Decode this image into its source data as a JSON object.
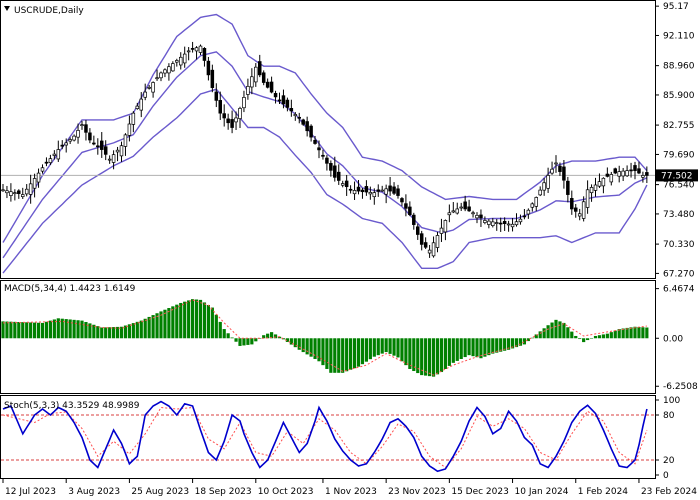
{
  "symbol_title": "USCRUDE,Daily",
  "colors": {
    "bollinger": "#6a5acd",
    "candle": "#000000",
    "macd_bar": "#008000",
    "macd_signal": "#ff4d4d",
    "stoch_main": "#0000cd",
    "stoch_signal": "#ff4d4d",
    "level_line": "#cc0000",
    "price_marker_bg": "#000000"
  },
  "chart_data": [
    {
      "type": "candlestick",
      "panel": "price",
      "title": "USCRUDE,Daily",
      "ylim": [
        67.0,
        95.5
      ],
      "y_ticks": [
        "95.17",
        "92.110",
        "88.960",
        "85.900",
        "82.755",
        "79.690",
        "76.540",
        "73.480",
        "70.330",
        "67.270"
      ],
      "current_price": "77.502",
      "x_ticks": [
        "12 Jul 2023",
        "3 Aug 2023",
        "25 Aug 2023",
        "18 Sep 2023",
        "10 Oct 2023",
        "1 Nov 2023",
        "23 Nov 2023",
        "15 Dec 2023",
        "10 Jan 2024",
        "1 Feb 2024",
        "23 Feb 2024"
      ],
      "close_anchors": [
        [
          0,
          76.0
        ],
        [
          5,
          75.5
        ],
        [
          10,
          78.3
        ],
        [
          14,
          80.2
        ],
        [
          18,
          81.6
        ],
        [
          20,
          82.8
        ],
        [
          22,
          81.2
        ],
        [
          25,
          80.2
        ],
        [
          27,
          79.2
        ],
        [
          30,
          80.6
        ],
        [
          33,
          84.0
        ],
        [
          36,
          86.2
        ],
        [
          40,
          88.2
        ],
        [
          44,
          89.5
        ],
        [
          47,
          90.5
        ],
        [
          50,
          91.0
        ],
        [
          52,
          88.0
        ],
        [
          55,
          84.0
        ],
        [
          58,
          82.5
        ],
        [
          60,
          84.5
        ],
        [
          62,
          86.8
        ],
        [
          64,
          88.8
        ],
        [
          66,
          87.2
        ],
        [
          69,
          85.7
        ],
        [
          72,
          84.6
        ],
        [
          75,
          83.5
        ],
        [
          78,
          81.5
        ],
        [
          81,
          79.5
        ],
        [
          84,
          77.3
        ],
        [
          88,
          76.0
        ],
        [
          91,
          75.8
        ],
        [
          94,
          75.7
        ],
        [
          97,
          76.1
        ],
        [
          100,
          75.4
        ],
        [
          103,
          73.4
        ],
        [
          106,
          70.3
        ],
        [
          108,
          69.7
        ],
        [
          111,
          72.0
        ],
        [
          113,
          73.6
        ],
        [
          116,
          74.2
        ],
        [
          119,
          73.6
        ],
        [
          122,
          72.8
        ],
        [
          126,
          72.5
        ],
        [
          129,
          72.4
        ],
        [
          132,
          73.2
        ],
        [
          135,
          75.2
        ],
        [
          138,
          77.5
        ],
        [
          140,
          78.8
        ],
        [
          142,
          77.0
        ],
        [
          144,
          74.0
        ],
        [
          146,
          73.5
        ],
        [
          148,
          76.0
        ],
        [
          150,
          76.5
        ],
        [
          152,
          77.2
        ],
        [
          154,
          77.6
        ],
        [
          156,
          77.9
        ],
        [
          158,
          78.0
        ],
        [
          160,
          78.0
        ],
        [
          162,
          77.5
        ],
        [
          163,
          77.5
        ]
      ],
      "bollinger_upper_anchors": [
        [
          0,
          70.5
        ],
        [
          10,
          77.5
        ],
        [
          20,
          83.3
        ],
        [
          28,
          83.3
        ],
        [
          33,
          84.0
        ],
        [
          38,
          88.0
        ],
        [
          44,
          92.0
        ],
        [
          50,
          94.0
        ],
        [
          54,
          94.3
        ],
        [
          58,
          93.3
        ],
        [
          62,
          90.0
        ],
        [
          66,
          88.9
        ],
        [
          70,
          88.9
        ],
        [
          74,
          88.2
        ],
        [
          78,
          86.0
        ],
        [
          82,
          84.0
        ],
        [
          86,
          82.5
        ],
        [
          91,
          79.4
        ],
        [
          96,
          79.0
        ],
        [
          101,
          78.0
        ],
        [
          106,
          76.3
        ],
        [
          112,
          75.0
        ],
        [
          118,
          75.3
        ],
        [
          124,
          75.0
        ],
        [
          130,
          75.0
        ],
        [
          136,
          76.8
        ],
        [
          140,
          78.5
        ],
        [
          144,
          79.0
        ],
        [
          150,
          79.0
        ],
        [
          156,
          79.4
        ],
        [
          160,
          79.4
        ],
        [
          163,
          78.0
        ]
      ],
      "bollinger_lower_anchors": [
        [
          0,
          67.3
        ],
        [
          10,
          72.5
        ],
        [
          20,
          76.5
        ],
        [
          28,
          78.5
        ],
        [
          33,
          79.5
        ],
        [
          38,
          81.5
        ],
        [
          44,
          83.5
        ],
        [
          50,
          86.0
        ],
        [
          54,
          86.5
        ],
        [
          58,
          84.5
        ],
        [
          62,
          82.5
        ],
        [
          66,
          82.5
        ],
        [
          70,
          81.5
        ],
        [
          74,
          79.6
        ],
        [
          78,
          77.8
        ],
        [
          82,
          75.5
        ],
        [
          86,
          74.5
        ],
        [
          91,
          73.0
        ],
        [
          96,
          72.5
        ],
        [
          101,
          70.5
        ],
        [
          106,
          67.8
        ],
        [
          110,
          67.8
        ],
        [
          114,
          68.5
        ],
        [
          118,
          70.5
        ],
        [
          124,
          71.0
        ],
        [
          130,
          71.0
        ],
        [
          136,
          71.0
        ],
        [
          140,
          71.2
        ],
        [
          144,
          70.5
        ],
        [
          150,
          71.5
        ],
        [
          156,
          71.5
        ],
        [
          160,
          74.0
        ],
        [
          163,
          76.5
        ]
      ]
    },
    {
      "type": "bar",
      "panel": "macd",
      "label": "MACD(5,34,4) 1.4423 1.6149",
      "ylim": [
        -7.0,
        7.2
      ],
      "y_ticks": [
        "6.4674",
        "0.00",
        "-6.2508"
      ],
      "value_anchors": [
        [
          0,
          2.2
        ],
        [
          10,
          2.0
        ],
        [
          14,
          2.6
        ],
        [
          20,
          2.3
        ],
        [
          25,
          1.4
        ],
        [
          30,
          1.5
        ],
        [
          35,
          2.3
        ],
        [
          40,
          3.5
        ],
        [
          45,
          4.6
        ],
        [
          48,
          5.1
        ],
        [
          50,
          5.0
        ],
        [
          53,
          4.0
        ],
        [
          56,
          1.2
        ],
        [
          60,
          -1.0
        ],
        [
          63,
          -0.8
        ],
        [
          66,
          0.4
        ],
        [
          68,
          0.8
        ],
        [
          70,
          0.2
        ],
        [
          75,
          -1.5
        ],
        [
          80,
          -3.0
        ],
        [
          83,
          -4.5
        ],
        [
          86,
          -4.5
        ],
        [
          90,
          -3.7
        ],
        [
          94,
          -2.4
        ],
        [
          97,
          -1.8
        ],
        [
          100,
          -2.5
        ],
        [
          103,
          -4.0
        ],
        [
          106,
          -4.8
        ],
        [
          109,
          -5.0
        ],
        [
          111,
          -4.4
        ],
        [
          114,
          -3.2
        ],
        [
          118,
          -2.2
        ],
        [
          121,
          -2.6
        ],
        [
          124,
          -2.0
        ],
        [
          128,
          -1.5
        ],
        [
          132,
          -0.8
        ],
        [
          135,
          0.5
        ],
        [
          138,
          1.7
        ],
        [
          140,
          2.4
        ],
        [
          142,
          2.0
        ],
        [
          145,
          0.3
        ],
        [
          147,
          -0.5
        ],
        [
          150,
          0.3
        ],
        [
          153,
          0.6
        ],
        [
          156,
          1.2
        ],
        [
          160,
          1.5
        ],
        [
          163,
          1.4
        ]
      ],
      "signal_anchors": [
        [
          0,
          2.0
        ],
        [
          15,
          2.2
        ],
        [
          25,
          1.4
        ],
        [
          30,
          1.3
        ],
        [
          40,
          3.0
        ],
        [
          48,
          5.0
        ],
        [
          52,
          4.3
        ],
        [
          56,
          2.0
        ],
        [
          60,
          0.0
        ],
        [
          66,
          0.0
        ],
        [
          70,
          0.2
        ],
        [
          80,
          -2.5
        ],
        [
          86,
          -4.3
        ],
        [
          92,
          -3.5
        ],
        [
          97,
          -2.0
        ],
        [
          103,
          -3.5
        ],
        [
          109,
          -4.8
        ],
        [
          114,
          -3.5
        ],
        [
          120,
          -2.4
        ],
        [
          130,
          -1.0
        ],
        [
          138,
          1.2
        ],
        [
          142,
          1.9
        ],
        [
          147,
          0.3
        ],
        [
          155,
          1.0
        ],
        [
          163,
          1.6
        ]
      ]
    },
    {
      "type": "line",
      "panel": "stochastic",
      "label": "Stoch(5,3,3) 43.3529 48.9989",
      "ylim": [
        0,
        100
      ],
      "y_ticks": [
        "100",
        "80",
        "20",
        "0"
      ],
      "levels": [
        80,
        20
      ],
      "main_anchors": [
        [
          0,
          88
        ],
        [
          2,
          92
        ],
        [
          5,
          55
        ],
        [
          8,
          80
        ],
        [
          10,
          88
        ],
        [
          12,
          80
        ],
        [
          14,
          90
        ],
        [
          16,
          85
        ],
        [
          18,
          70
        ],
        [
          20,
          50
        ],
        [
          22,
          20
        ],
        [
          24,
          10
        ],
        [
          26,
          35
        ],
        [
          28,
          60
        ],
        [
          30,
          42
        ],
        [
          32,
          15
        ],
        [
          34,
          25
        ],
        [
          36,
          80
        ],
        [
          38,
          92
        ],
        [
          40,
          98
        ],
        [
          42,
          92
        ],
        [
          44,
          80
        ],
        [
          46,
          95
        ],
        [
          48,
          92
        ],
        [
          50,
          60
        ],
        [
          52,
          30
        ],
        [
          54,
          20
        ],
        [
          56,
          45
        ],
        [
          58,
          80
        ],
        [
          60,
          72
        ],
        [
          61,
          55
        ],
        [
          63,
          30
        ],
        [
          65,
          10
        ],
        [
          67,
          20
        ],
        [
          69,
          45
        ],
        [
          71,
          70
        ],
        [
          73,
          50
        ],
        [
          75,
          30
        ],
        [
          77,
          42
        ],
        [
          79,
          72
        ],
        [
          80,
          90
        ],
        [
          82,
          72
        ],
        [
          84,
          48
        ],
        [
          86,
          32
        ],
        [
          88,
          20
        ],
        [
          90,
          12
        ],
        [
          92,
          15
        ],
        [
          94,
          30
        ],
        [
          96,
          48
        ],
        [
          98,
          70
        ],
        [
          100,
          75
        ],
        [
          102,
          65
        ],
        [
          104,
          50
        ],
        [
          106,
          25
        ],
        [
          108,
          12
        ],
        [
          110,
          5
        ],
        [
          112,
          8
        ],
        [
          114,
          25
        ],
        [
          116,
          45
        ],
        [
          118,
          72
        ],
        [
          120,
          90
        ],
        [
          122,
          78
        ],
        [
          124,
          55
        ],
        [
          126,
          62
        ],
        [
          128,
          85
        ],
        [
          130,
          72
        ],
        [
          132,
          50
        ],
        [
          134,
          40
        ],
        [
          136,
          15
        ],
        [
          138,
          10
        ],
        [
          140,
          25
        ],
        [
          142,
          45
        ],
        [
          144,
          70
        ],
        [
          146,
          85
        ],
        [
          148,
          93
        ],
        [
          150,
          82
        ],
        [
          152,
          60
        ],
        [
          154,
          35
        ],
        [
          156,
          12
        ],
        [
          158,
          10
        ],
        [
          160,
          20
        ],
        [
          161,
          40
        ],
        [
          162,
          65
        ],
        [
          163,
          88
        ]
      ],
      "signal_anchors": [
        [
          0,
          80
        ],
        [
          4,
          75
        ],
        [
          8,
          70
        ],
        [
          12,
          82
        ],
        [
          16,
          84
        ],
        [
          20,
          62
        ],
        [
          24,
          25
        ],
        [
          28,
          45
        ],
        [
          32,
          28
        ],
        [
          36,
          55
        ],
        [
          40,
          90
        ],
        [
          44,
          88
        ],
        [
          48,
          90
        ],
        [
          52,
          48
        ],
        [
          56,
          35
        ],
        [
          60,
          70
        ],
        [
          64,
          30
        ],
        [
          68,
          25
        ],
        [
          72,
          58
        ],
        [
          76,
          42
        ],
        [
          80,
          75
        ],
        [
          84,
          60
        ],
        [
          88,
          30
        ],
        [
          92,
          15
        ],
        [
          96,
          38
        ],
        [
          100,
          68
        ],
        [
          104,
          58
        ],
        [
          108,
          25
        ],
        [
          112,
          10
        ],
        [
          116,
          35
        ],
        [
          120,
          78
        ],
        [
          124,
          65
        ],
        [
          128,
          75
        ],
        [
          132,
          62
        ],
        [
          136,
          30
        ],
        [
          140,
          20
        ],
        [
          144,
          55
        ],
        [
          148,
          85
        ],
        [
          152,
          72
        ],
        [
          156,
          30
        ],
        [
          160,
          15
        ],
        [
          163,
          60
        ]
      ]
    }
  ]
}
